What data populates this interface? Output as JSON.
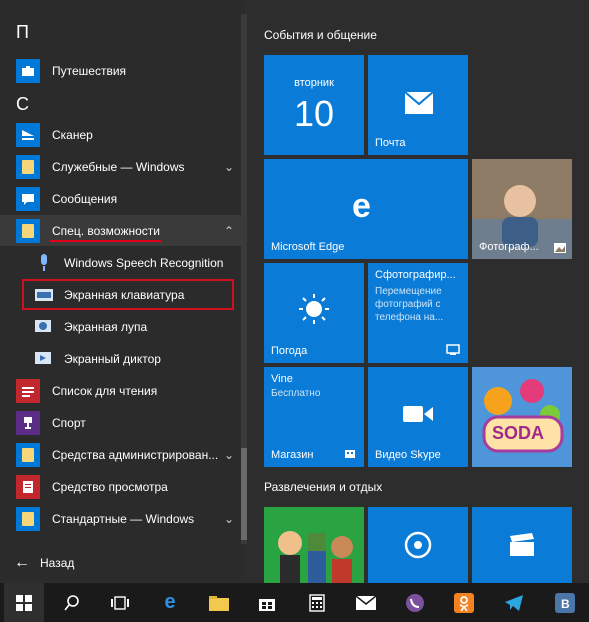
{
  "applist": {
    "letter_p": "П",
    "letter_c": "С",
    "items": [
      {
        "label": "Путешествия"
      },
      {
        "label": "Сканер"
      },
      {
        "label": "Служебные — Windows"
      },
      {
        "label": "Сообщения"
      },
      {
        "label": "Спец. возможности"
      },
      {
        "label": "Windows Speech Recognition"
      },
      {
        "label": "Экранная клавиатура"
      },
      {
        "label": "Экранная лупа"
      },
      {
        "label": "Экранный диктор"
      },
      {
        "label": "Список для чтения"
      },
      {
        "label": "Спорт"
      },
      {
        "label": "Средства администрирован..."
      },
      {
        "label": "Средство просмотра"
      },
      {
        "label": "Стандартные — Windows"
      }
    ],
    "back_label": "Назад"
  },
  "tiles": {
    "group1_title": "События и общение",
    "group2_title": "Развлечения и отдых",
    "calendar_day": "вторник",
    "calendar_date": "10",
    "mail": "Почта",
    "edge": "Microsoft Edge",
    "photos": "Фотограф...",
    "photos_app_title": "Сфотографир...",
    "photos_app_text": "Перемещение фотографий с телефона на...",
    "weather": "Погода",
    "vine_title": "Vine",
    "vine_sub": "Бесплатно",
    "store": "Магазин",
    "skype": "Видео Skype",
    "candy_text": "SODA"
  },
  "colors": {
    "tile_blue": "#0a7bd6",
    "accent_red": "#e0001a"
  }
}
